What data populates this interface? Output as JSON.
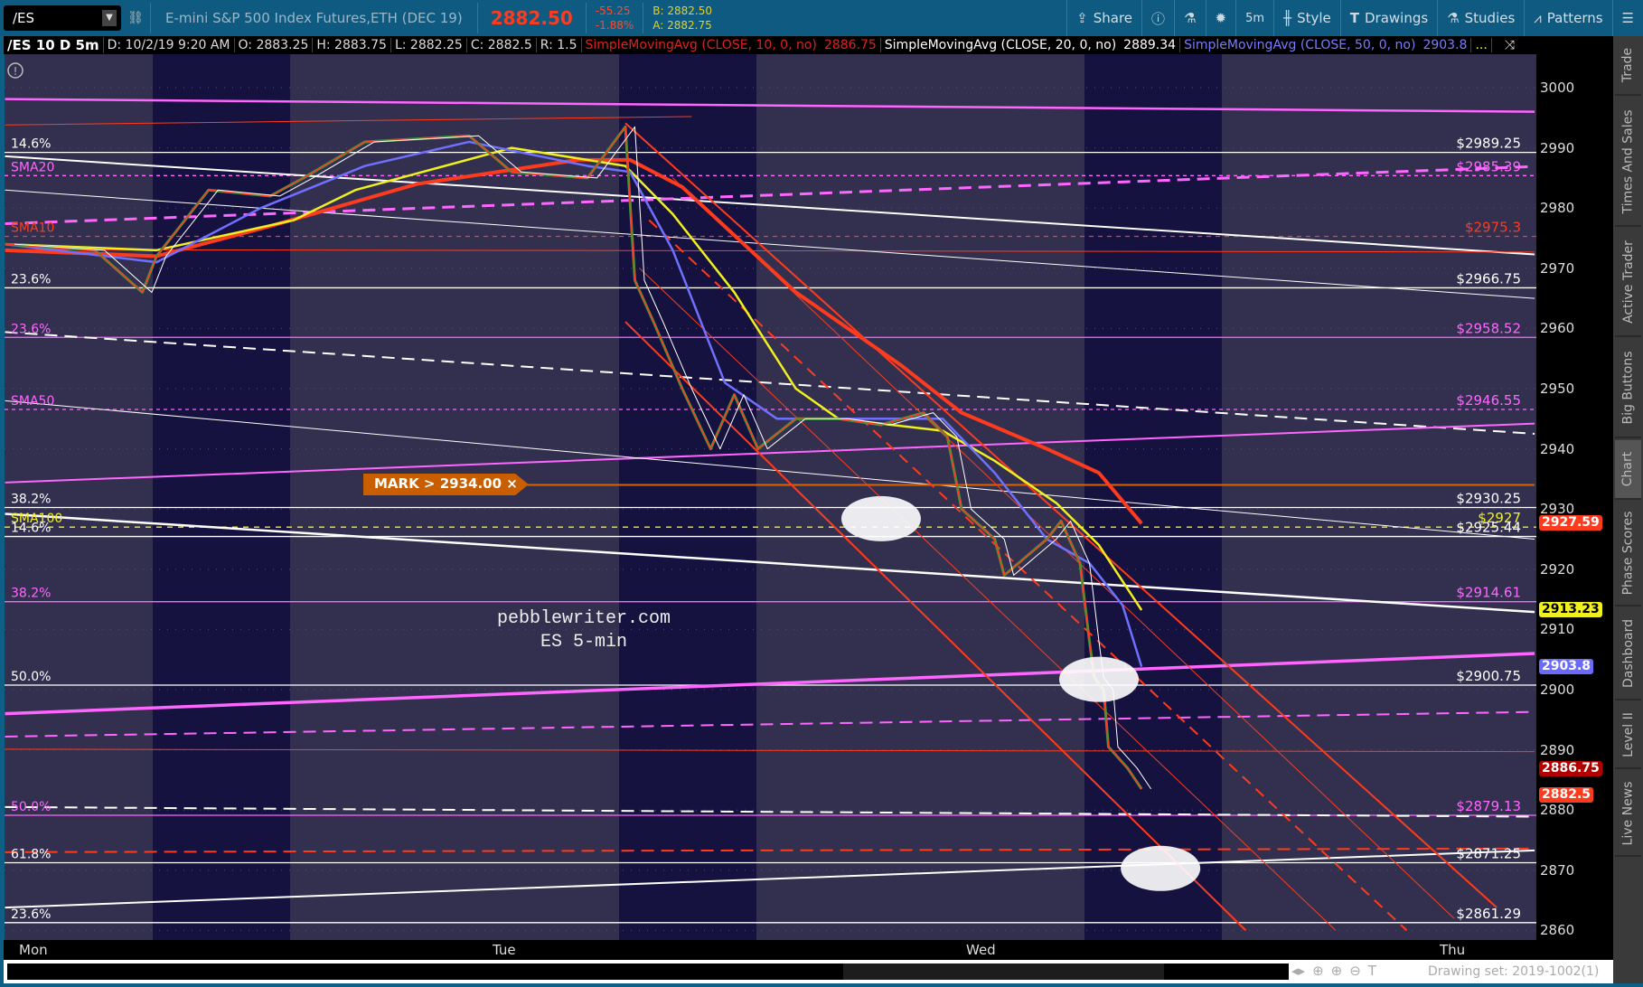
{
  "toolbar": {
    "symbol": "/ES",
    "description": "E-mini S&P 500 Index Futures,ETH (DEC 19)",
    "last": "2882.50",
    "change": "-55.25",
    "change_pct": "-1.88%",
    "bid": "B: 2882.50",
    "ask": "A: 2882.75",
    "share": "Share",
    "timeframe": "5m",
    "style": "Style",
    "drawings": "Drawings",
    "studies": "Studies",
    "patterns": "Patterns"
  },
  "infobar": {
    "title": "/ES 10 D 5m",
    "date": "D: 10/2/19 9:20 AM",
    "open": "O: 2883.25",
    "high": "H: 2883.75",
    "low": "L: 2882.25",
    "close": "C: 2882.5",
    "range": "R: 1.5",
    "sma10": "SimpleMovingAvg (CLOSE, 10, 0, no)",
    "sma10_val": "2886.75",
    "sma20": "SimpleMovingAvg (CLOSE, 20, 0, no)",
    "sma20_val": "2889.34",
    "sma50": "SimpleMovingAvg (CLOSE, 50, 0, no)",
    "sma50_val": "2903.8",
    "more": "..."
  },
  "sidebar": [
    "Trade",
    "Times And Sales",
    "Active Trader",
    "Big Buttons",
    "Chart",
    "Phase Scores",
    "Dashboard",
    "Level II",
    "Live News"
  ],
  "mark_label": "MARK > 2934.00 ×",
  "watermark": [
    "pebblewriter.com",
    "ES 5-min"
  ],
  "drawing_set": "Drawing set: 2019-1002(1)",
  "chart_data": {
    "type": "line",
    "title": "/ES 10 D 5m",
    "x_ticks": [
      "Mon",
      "Tue",
      "Wed",
      "Thu"
    ],
    "y_ticks": [
      3000,
      2990,
      2980,
      2970,
      2960,
      2950,
      2940,
      2930,
      2920,
      2910,
      2900,
      2890,
      2880,
      2870,
      2860
    ],
    "ylim": [
      2858,
      3005
    ],
    "colors": {
      "price": "#ff3b1e",
      "sma10": "#ffffff",
      "sma20": "#f0f020",
      "sma50": "#7070ff",
      "sma_red": "#ff3b1e",
      "magenta": "#ff66ff",
      "white": "#ffffff"
    },
    "price": [
      [
        -0.06,
        2974
      ],
      [
        0.13,
        2973
      ],
      [
        0.23,
        2966
      ],
      [
        0.26,
        2972
      ],
      [
        0.37,
        2983
      ],
      [
        0.5,
        2982
      ],
      [
        0.57,
        2985
      ],
      [
        0.7,
        2991
      ],
      [
        0.92,
        2992
      ],
      [
        1.01,
        2986
      ],
      [
        1.17,
        2985
      ],
      [
        1.25,
        2993.5
      ],
      [
        1.27,
        2968
      ],
      [
        1.31,
        2961
      ],
      [
        1.37,
        2950
      ],
      [
        1.43,
        2940
      ],
      [
        1.48,
        2949
      ],
      [
        1.53,
        2940
      ],
      [
        1.61,
        2945
      ],
      [
        1.7,
        2945
      ],
      [
        1.79,
        2944
      ],
      [
        1.88,
        2946
      ],
      [
        1.93,
        2942
      ],
      [
        1.96,
        2930
      ],
      [
        2.03,
        2925
      ],
      [
        2.05,
        2919
      ],
      [
        2.14,
        2925
      ],
      [
        2.17,
        2928
      ],
      [
        2.21,
        2921
      ],
      [
        2.23,
        2908
      ],
      [
        2.24,
        2902
      ],
      [
        2.26,
        2900
      ],
      [
        2.27,
        2890.5
      ],
      [
        2.31,
        2887
      ],
      [
        2.34,
        2883.5
      ]
    ],
    "sma20": [
      [
        -0.06,
        2974
      ],
      [
        0.26,
        2973
      ],
      [
        0.55,
        2978
      ],
      [
        0.68,
        2983
      ],
      [
        1.01,
        2990
      ],
      [
        1.25,
        2987
      ],
      [
        1.35,
        2979
      ],
      [
        1.48,
        2966
      ],
      [
        1.61,
        2950
      ],
      [
        1.7,
        2945
      ],
      [
        1.92,
        2943
      ],
      [
        2.03,
        2938
      ],
      [
        2.16,
        2931
      ],
      [
        2.25,
        2924
      ],
      [
        2.34,
        2913.2
      ]
    ],
    "sma_red": [
      [
        -0.06,
        2973
      ],
      [
        0.26,
        2972
      ],
      [
        0.5,
        2977
      ],
      [
        0.81,
        2984
      ],
      [
        1.15,
        2988
      ],
      [
        1.26,
        2988
      ],
      [
        1.37,
        2983.5
      ],
      [
        1.61,
        2966
      ],
      [
        1.83,
        2954
      ],
      [
        1.96,
        2946
      ],
      [
        2.14,
        2940
      ],
      [
        2.25,
        2936
      ],
      [
        2.34,
        2927.6
      ]
    ],
    "sma50": [
      [
        -0.06,
        2974
      ],
      [
        0.26,
        2971
      ],
      [
        0.48,
        2980
      ],
      [
        0.7,
        2987
      ],
      [
        0.92,
        2991
      ],
      [
        1.17,
        2987
      ],
      [
        1.26,
        2986
      ],
      [
        1.35,
        2973
      ],
      [
        1.46,
        2951
      ],
      [
        1.57,
        2945
      ],
      [
        1.92,
        2945
      ],
      [
        2.03,
        2936
      ],
      [
        2.14,
        2925
      ],
      [
        2.23,
        2921
      ],
      [
        2.3,
        2914
      ],
      [
        2.34,
        2903.8
      ]
    ],
    "levels": [
      {
        "price": 2989.25,
        "label": "$2989.25",
        "left": "14.6%",
        "color": "#ffffff",
        "dash": ""
      },
      {
        "price": 2985.39,
        "label": "$2985.39",
        "left": "SMA20",
        "color": "#ff66ff",
        "dash": "4 4"
      },
      {
        "price": 2975.3,
        "label": "$2975.3",
        "left": "SMA10",
        "color": "#ff3b1e",
        "dash": "5 5"
      },
      {
        "price": 2966.75,
        "label": "$2966.75",
        "left": "23.6%",
        "color": "#ffffff",
        "dash": ""
      },
      {
        "price": 2958.52,
        "label": "$2958.52",
        "left": "23.6%",
        "color": "#ff66ff",
        "dash": ""
      },
      {
        "price": 2946.55,
        "label": "$2946.55",
        "left": "SMA50",
        "color": "#ff66ff",
        "dash": "4 4"
      },
      {
        "price": 2930.25,
        "label": "$2930.25",
        "left": "38.2%",
        "color": "#ffffff",
        "dash": ""
      },
      {
        "price": 2927,
        "label": "$2927",
        "left": "SMA100",
        "color": "#f0f020",
        "dash": "6 6"
      },
      {
        "price": 2925.44,
        "label": "$2925.44",
        "left": "14.6%",
        "color": "#ffffff",
        "dash": ""
      },
      {
        "price": 2914.61,
        "label": "$2914.61",
        "left": "38.2%",
        "color": "#ff66ff",
        "dash": ""
      },
      {
        "price": 2900.75,
        "label": "$2900.75",
        "left": "50.0%",
        "color": "#ffffff",
        "dash": ""
      },
      {
        "price": 2879.13,
        "label": "$2879.13",
        "left": "50.0%",
        "color": "#ff66ff",
        "dash": ""
      },
      {
        "price": 2871.25,
        "label": "$2871.25",
        "left": "61.8%",
        "color": "#ffffff",
        "dash": ""
      },
      {
        "price": 2861.29,
        "label": "$2861.29",
        "left": "23.6%",
        "color": "#ffffff",
        "dash": ""
      }
    ],
    "trendlines": [
      {
        "p": [
          -0.06,
          2998.1,
          3.17,
          2996.0
        ],
        "color": "#ff66ff",
        "w": 2.5,
        "dash": ""
      },
      {
        "p": [
          -0.06,
          2988.6,
          3.17,
          2972.3
        ],
        "color": "#ffffff",
        "w": 2,
        "dash": ""
      },
      {
        "p": [
          -0.06,
          2977.4,
          3.17,
          2986.9
        ],
        "color": "#ff66ff",
        "w": 3,
        "dash": "14 8"
      },
      {
        "p": [
          -0.06,
          2959.4,
          3.17,
          2942.5
        ],
        "color": "#ffffff",
        "w": 2,
        "dash": "14 8"
      },
      {
        "p": [
          -0.06,
          2934.4,
          3.17,
          2944.2
        ],
        "color": "#ff66ff",
        "w": 2,
        "dash": ""
      },
      {
        "p": [
          -0.06,
          2929.2,
          3.17,
          2912.9
        ],
        "color": "#ffffff",
        "w": 2.5,
        "dash": ""
      },
      {
        "p": [
          -0.06,
          2896.0,
          3.17,
          2906.0
        ],
        "color": "#ff66ff",
        "w": 3.5,
        "dash": ""
      },
      {
        "p": [
          -0.06,
          2892.2,
          3.17,
          2896.3
        ],
        "color": "#ff66ff",
        "w": 2,
        "dash": "14 8"
      },
      {
        "p": [
          -0.06,
          2863.8,
          3.17,
          2873.3
        ],
        "color": "#ffffff",
        "w": 2,
        "dash": ""
      },
      {
        "p": [
          -0.06,
          2880.5,
          3.17,
          2878.9
        ],
        "color": "#ffffff",
        "w": 2,
        "dash": "14 8"
      },
      {
        "p": [
          -0.06,
          2873.0,
          3.17,
          2873.6
        ],
        "color": "#ff3b1e",
        "w": 2,
        "dash": "14 8"
      },
      {
        "p": [
          -0.06,
          2973.1,
          3.17,
          2972.7
        ],
        "color": "#ff3b1e",
        "w": 1,
        "dash": ""
      },
      {
        "p": [
          -0.06,
          2890.1,
          3.17,
          2889.7
        ],
        "color": "#ff3b1e",
        "w": 1,
        "dash": ""
      },
      {
        "p": [
          -0.06,
          2993.8,
          1.39,
          2995.2
        ],
        "color": "#ff3b1e",
        "w": 1,
        "dash": ""
      },
      {
        "p": [
          -0.06,
          2983.0,
          3.17,
          2965.0
        ],
        "color": "#ffffff",
        "w": 1,
        "dash": ""
      },
      {
        "p": [
          -0.06,
          2948.0,
          3.17,
          2925.0
        ],
        "color": "#ffffff",
        "w": 1,
        "dash": ""
      },
      {
        "p": [
          1.0,
          2934.0,
          3.17,
          2934.0
        ],
        "color": "#d86400",
        "w": 2,
        "dash": ""
      },
      {
        "p": [
          1.25,
          2994.1,
          3.09,
          2863.8
        ],
        "color": "#ff3b1e",
        "w": 2,
        "dash": ""
      },
      {
        "p": [
          1.25,
          2961.1,
          2.56,
          2860.0
        ],
        "color": "#ff3b1e",
        "w": 2,
        "dash": ""
      },
      {
        "p": [
          1.3,
          2978.0,
          2.9,
          2860.0
        ],
        "color": "#ff3b1e",
        "w": 2,
        "dash": "12 8"
      },
      {
        "p": [
          1.35,
          2985.0,
          3.0,
          2862.0
        ],
        "color": "#ff3b1e",
        "w": 1,
        "dash": ""
      },
      {
        "p": [
          1.28,
          2970.0,
          2.75,
          2860.0
        ],
        "color": "#ff3b1e",
        "w": 1,
        "dash": ""
      }
    ],
    "ellipses": [
      [
        1.79,
        2928.4
      ],
      [
        2.25,
        2901.7
      ],
      [
        2.38,
        2870.3
      ]
    ],
    "badges": [
      {
        "price": 2927.59,
        "label": "2927.59",
        "bg": "#ff3b1e",
        "fg": "#ffffff"
      },
      {
        "price": 2913.23,
        "label": "2913.23",
        "bg": "#f0f020",
        "fg": "#000000"
      },
      {
        "price": 2903.8,
        "label": "2903.8",
        "bg": "#6a6aff",
        "fg": "#ffffff"
      },
      {
        "price": 2886.75,
        "label": "2886.75",
        "bg": "#b00000",
        "fg": "#ffffff"
      },
      {
        "price": 2882.5,
        "label": "2882.5",
        "bg": "#ff3b1e",
        "fg": "#ffffff"
      }
    ]
  }
}
